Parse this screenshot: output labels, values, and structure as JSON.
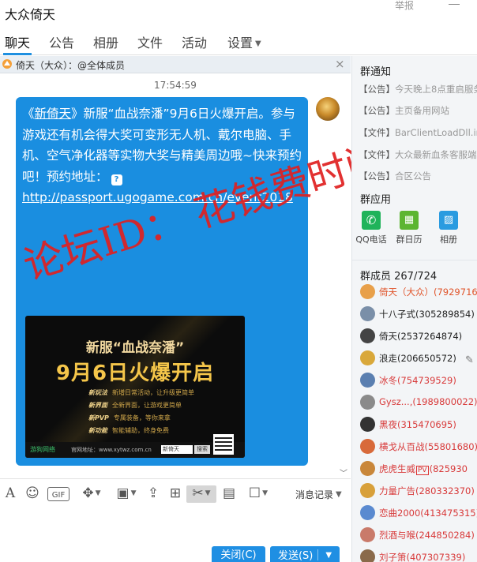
{
  "window": {
    "title": "大众倚天",
    "report_label": "举报"
  },
  "tabs": [
    {
      "label": "聊天"
    },
    {
      "label": "公告"
    },
    {
      "label": "相册"
    },
    {
      "label": "文件"
    },
    {
      "label": "活动"
    },
    {
      "label": "设置"
    }
  ],
  "notice_bar": {
    "text": "倚天（大众）：@全体成员"
  },
  "chat": {
    "timestamp": "17:54:59",
    "message": {
      "text_prefix": "《",
      "game_name": "新倚天",
      "text_body": "》新服“血战奈潘”9月6日火爆开启。参与游戏还有机会得大奖可变形无人机、戴尔电脑、手机、空气净化器等实物大奖与精美周边哦~快来预约吧！预约地址：",
      "qmark": "?",
      "link": "http://passport.ugogame.com.cn/event2018"
    },
    "promo": {
      "line1": "新服“血战奈潘”",
      "line2": "9月6日火爆开启",
      "features": [
        {
          "tag": "新玩法",
          "desc": "新增日常活动，让升级更简单"
        },
        {
          "tag": "新界面",
          "desc": "全新界面，让游戏更简单"
        },
        {
          "tag": "新PVP",
          "desc": "专属装备，等你来拿"
        },
        {
          "tag": "新功能",
          "desc": "智能辅助，终身免费"
        }
      ],
      "logo": "游狗网络",
      "site": "官网地址：www.xytwz.com.cn",
      "search_text": "新倚天",
      "search_btn": "搜索"
    },
    "watermark": "论坛ID： 花钱费时间"
  },
  "toolbar": {
    "history_label": "消息记录"
  },
  "buttons": {
    "close": "关闭(C)",
    "send": "发送(S)"
  },
  "right_panel": {
    "notice_title": "群通知",
    "notices": [
      {
        "tag": "【公告】",
        "text": "今天晚上8点重启服务器"
      },
      {
        "tag": "【公告】",
        "text": "主页备用网站"
      },
      {
        "tag": "【文件】",
        "text": "BarClientLoadDll.ini"
      },
      {
        "tag": "【文件】",
        "text": "大众最新血条客服端"
      },
      {
        "tag": "【公告】",
        "text": "合区公告"
      }
    ],
    "apps_title": "群应用",
    "apps": [
      {
        "label": "QQ电话",
        "color": "#1fb35a"
      },
      {
        "label": "群日历",
        "color": "#5cb531"
      },
      {
        "label": "相册",
        "color": "#2a9be0"
      }
    ],
    "members_title": "群成员 267/724",
    "members": [
      {
        "name": "倚天（大众）(79297163",
        "color": "#e0542a",
        "badge": ""
      },
      {
        "name": "十八子式(305289854)",
        "color": "#222222",
        "badge": ""
      },
      {
        "name": "倚天(2537264874)",
        "color": "#222222",
        "badge": ""
      },
      {
        "name": "浪走(206650572)",
        "color": "#222222",
        "badge": ""
      },
      {
        "name": "冰冬(754739529)",
        "color": "#d83a3a",
        "badge": ""
      },
      {
        "name": "Gysz...,(1989800022)",
        "color": "#d83a3a",
        "badge": ""
      },
      {
        "name": "黑夜(315470695)",
        "color": "#d83a3a",
        "badge": ""
      },
      {
        "name": "横戈从百战(55801680)",
        "color": "#d83a3a",
        "badge": ""
      },
      {
        "name": "虎虎生威",
        "color": "#d83a3a",
        "badge": "PV",
        "suffix": "(825930"
      },
      {
        "name": "力量广告(280332370)",
        "color": "#d83a3a",
        "badge": ""
      },
      {
        "name": "恋曲2000(413475315)",
        "color": "#d83a3a",
        "badge": ""
      },
      {
        "name": "烈酒与喉(244850284)",
        "color": "#d83a3a",
        "badge": ""
      },
      {
        "name": "刘子箫(407307339)",
        "color": "#d83a3a",
        "badge": ""
      }
    ]
  }
}
